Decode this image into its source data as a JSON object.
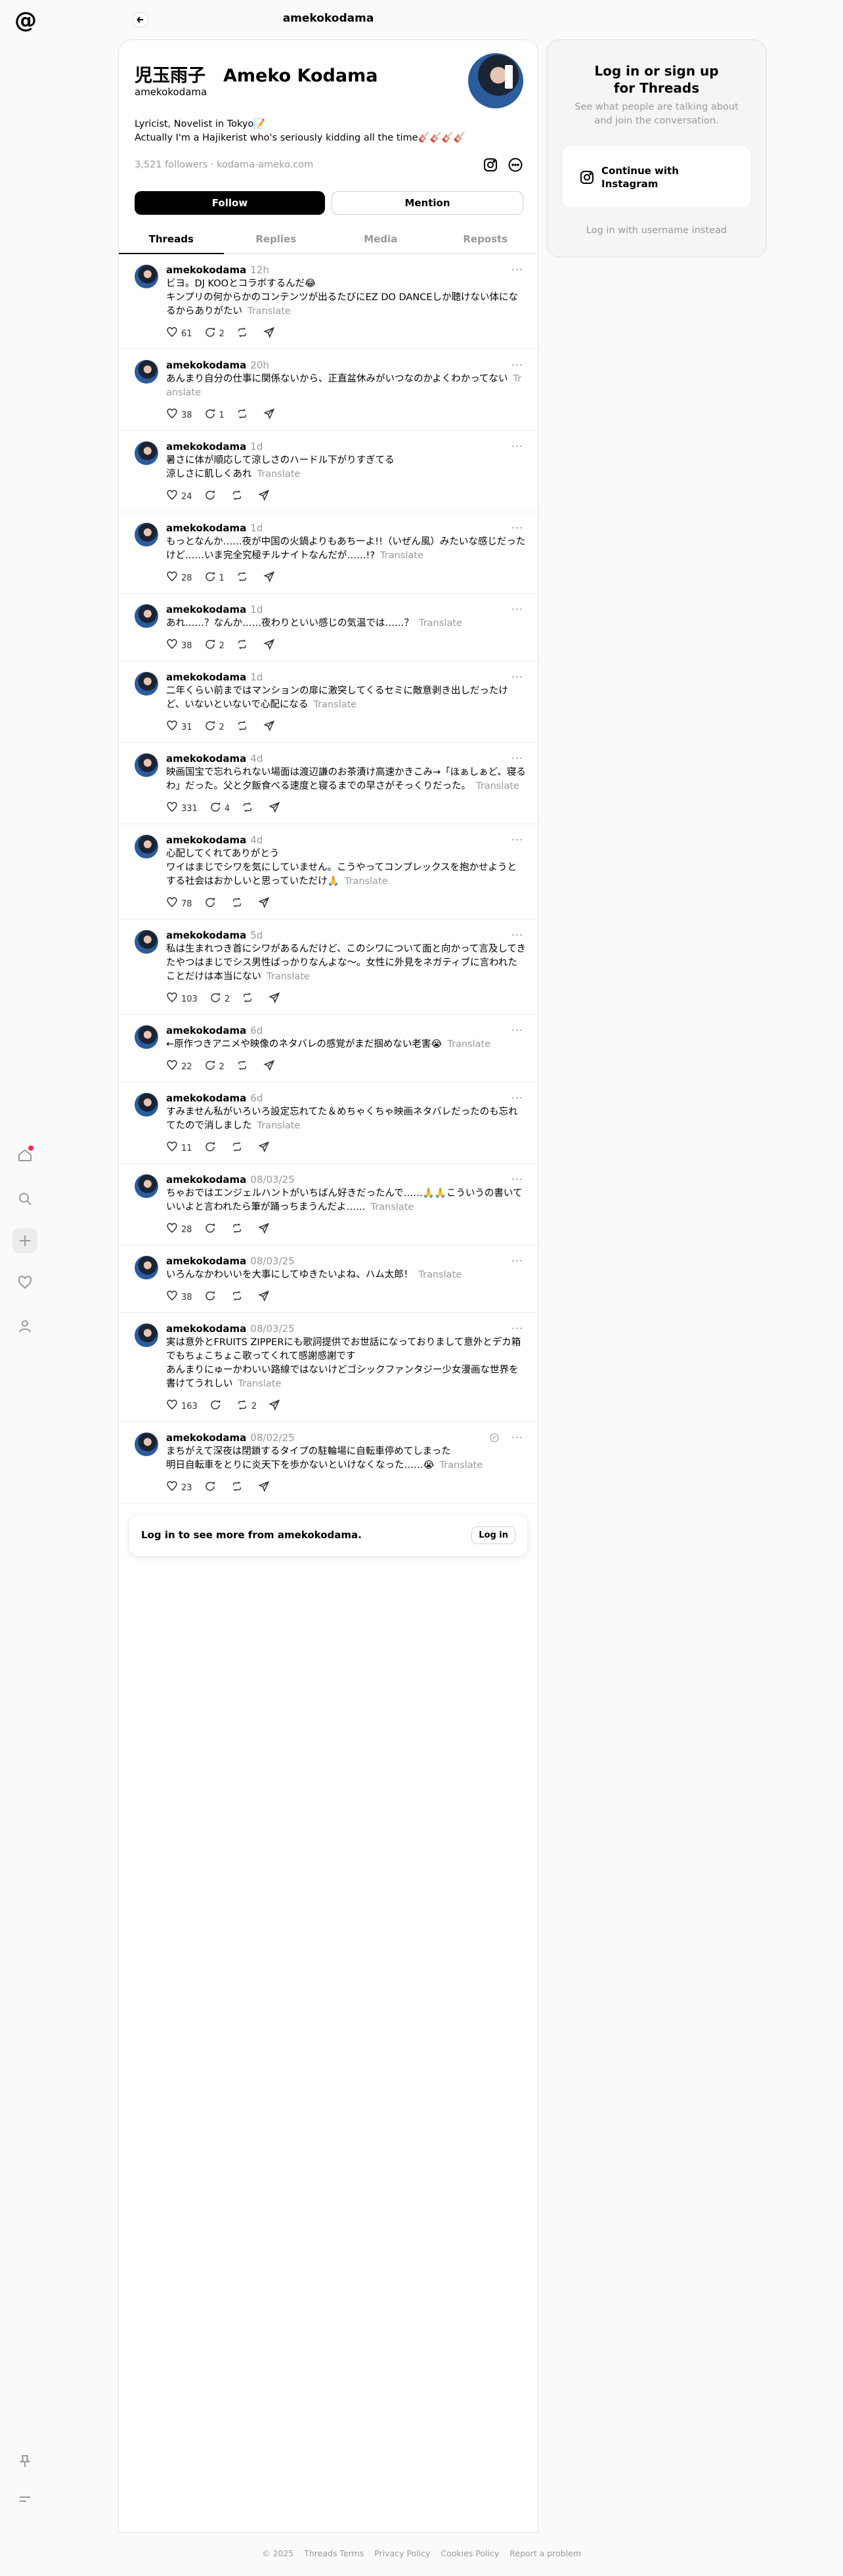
{
  "header": {
    "title": "amekokodama"
  },
  "profile": {
    "display_name": "児玉雨子　Ameko Kodama",
    "handle": "amekokodama",
    "bio_line1": "Lyricist, Novelist in Tokyo📝",
    "bio_line2": "Actually I'm a Hajikerist who's seriously kidding all the time🎸🎸🎸🎸",
    "followers": "3,521 followers",
    "link": "kodama-ameko.com",
    "follow_label": "Follow",
    "mention_label": "Mention"
  },
  "tabs": [
    "Threads",
    "Replies",
    "Media",
    "Reposts"
  ],
  "translate_label": "Translate",
  "posts": [
    {
      "user": "amekokodama",
      "time": "12h",
      "text": "ビヨ。DJ KOOとコラボするんだ😂\nキンプリの何からかのコンテンツが出るたびにEZ DO DANCEしか聴けない体になるからありがたい",
      "likes": "61",
      "replies": "2",
      "reposts": "",
      "shares": ""
    },
    {
      "user": "amekokodama",
      "time": "20h",
      "text": "あんまり自分の仕事に関係ないから、正直盆休みがいつなのかよくわかってない",
      "likes": "38",
      "replies": "1",
      "reposts": "",
      "shares": ""
    },
    {
      "user": "amekokodama",
      "time": "1d",
      "text": "暑さに体が順応して涼しさのハードル下がりすぎてる\n涼しさに飢しくあれ",
      "likes": "24",
      "replies": "",
      "reposts": "",
      "shares": ""
    },
    {
      "user": "amekokodama",
      "time": "1d",
      "text": "もっとなんか……夜が中国の火鍋よりもあちーよ!!（いぜん風）みたいな感じだったけど……いま完全究極チルナイトなんだが……!?",
      "likes": "28",
      "replies": "1",
      "reposts": "",
      "shares": ""
    },
    {
      "user": "amekokodama",
      "time": "1d",
      "text": "あれ……？なんか……夜わりといい感じの気温では……？",
      "likes": "38",
      "replies": "2",
      "reposts": "",
      "shares": ""
    },
    {
      "user": "amekokodama",
      "time": "1d",
      "text": "二年くらい前まではマンションの扉に激突してくるセミに敵意剥き出しだったけど、いないといないで心配になる",
      "likes": "31",
      "replies": "2",
      "reposts": "",
      "shares": ""
    },
    {
      "user": "amekokodama",
      "time": "4d",
      "text": "映画国宝で忘れられない場面は渡辺謙のお茶漬け高速かきこみ→「ほぁしぁど、寝るわ」だった。父と夕飯食べる速度と寝るまでの早さがそっくりだった。",
      "likes": "331",
      "replies": "4",
      "reposts": "",
      "shares": ""
    },
    {
      "user": "amekokodama",
      "time": "4d",
      "text": "心配してくれてありがとう\nワイはまじでシワを気にしていません。こうやってコンプレックスを抱かせようとする社会はおかしいと思っていただけ🙏",
      "likes": "78",
      "replies": "",
      "reposts": "",
      "shares": ""
    },
    {
      "user": "amekokodama",
      "time": "5d",
      "text": "私は生まれつき首にシワがあるんだけど、このシワについて面と向かって言及してきたやつはまじでシス男性ばっかりなんよな〜。女性に外見をネガティブに言われたことだけは本当にない",
      "likes": "103",
      "replies": "2",
      "reposts": "",
      "shares": ""
    },
    {
      "user": "amekokodama",
      "time": "6d",
      "text": "←原作つきアニメや映像のネタバレの感覚がまだ掴めない老害😭",
      "likes": "22",
      "replies": "2",
      "reposts": "",
      "shares": ""
    },
    {
      "user": "amekokodama",
      "time": "6d",
      "text": "すみません私がいろいろ設定忘れてた＆めちゃくちゃ映画ネタバレだったのも忘れてたので消しました",
      "likes": "11",
      "replies": "",
      "reposts": "",
      "shares": ""
    },
    {
      "user": "amekokodama",
      "time": "08/03/25",
      "text": "ちゃおではエンジェルハントがいちばん好きだったんで……🙏🙏こういうの書いていいよと言われたら筆が踊っちまうんだよ……",
      "likes": "28",
      "replies": "",
      "reposts": "",
      "shares": ""
    },
    {
      "user": "amekokodama",
      "time": "08/03/25",
      "text": "いろんなかわいいを大事にしてゆきたいよね、ハム太郎！",
      "likes": "38",
      "replies": "",
      "reposts": "",
      "shares": ""
    },
    {
      "user": "amekokodama",
      "time": "08/03/25",
      "text": "実は意外とFRUITS ZIPPERにも歌詞提供でお世話になっておりまして意外とデカ箱でもちょこちょこ歌ってくれて感謝感謝です\nあんまりにゅーかわいい路線ではないけどゴシックファンタジー少女漫画な世界を書けてうれしい",
      "likes": "163",
      "replies": "",
      "reposts": "2",
      "shares": ""
    },
    {
      "user": "amekokodama",
      "time": "08/02/25",
      "text": "まちがえて深夜は閉鎖するタイプの駐輪場に自転車停めてしまった\n明日自転車をとりに炎天下を歩かないといけなくなった……😭",
      "likes": "23",
      "replies": "",
      "reposts": "",
      "shares": "",
      "edited": true
    }
  ],
  "login_prompt": {
    "text": "Log in to see more from amekokodama.",
    "button": "Log in"
  },
  "side_panel": {
    "title": "Log in or sign up for Threads",
    "subtitle": "See what people are talking about and join the conversation.",
    "instagram_label": "Continue with Instagram",
    "username_link": "Log in with username instead"
  },
  "footer": [
    "© 2025",
    "Threads Terms",
    "Privacy Policy",
    "Cookies Policy",
    "Report a problem"
  ],
  "colors": {
    "accent": "#000000",
    "muted": "#999999",
    "notification": "#ff2a4d"
  }
}
